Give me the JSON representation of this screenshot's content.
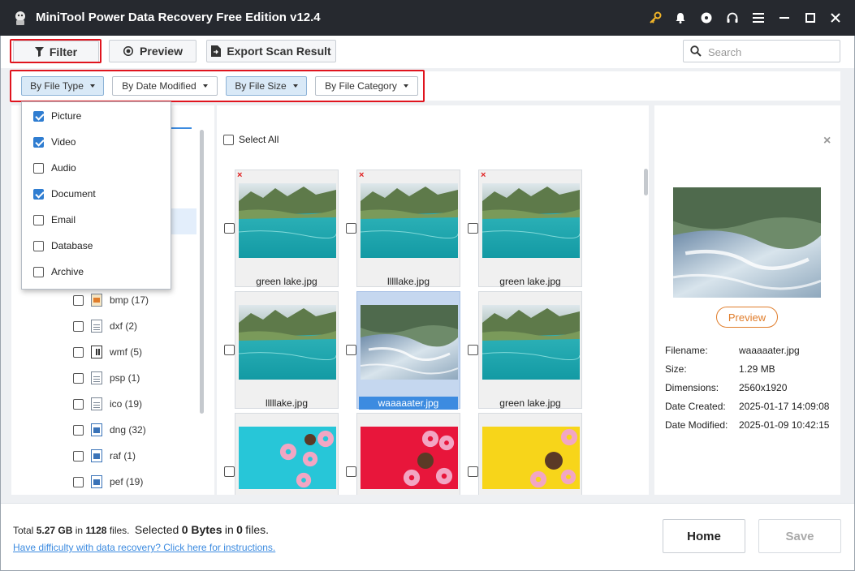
{
  "window": {
    "title": "MiniTool Power Data Recovery Free Edition v12.4"
  },
  "toolbar": {
    "filter_label": "Filter",
    "preview_label": "Preview",
    "export_label": "Export Scan Result",
    "search_placeholder": "Search"
  },
  "filterbar": {
    "by_file_type": "By File Type",
    "by_date_modified": "By Date Modified",
    "by_file_size": "By File Size",
    "by_file_category": "By File Category"
  },
  "file_type_dropdown": {
    "items": [
      {
        "label": "Picture",
        "checked": true
      },
      {
        "label": "Video",
        "checked": true
      },
      {
        "label": "Audio",
        "checked": false
      },
      {
        "label": "Document",
        "checked": true
      },
      {
        "label": "Email",
        "checked": false
      },
      {
        "label": "Database",
        "checked": false
      },
      {
        "label": "Archive",
        "checked": false
      }
    ]
  },
  "tree": {
    "items": [
      {
        "label": "bmp (17)",
        "icon": "bmp-file-icon"
      },
      {
        "label": "dxf (2)",
        "icon": "file-icon"
      },
      {
        "label": "wmf (5)",
        "icon": "wmf-file-icon"
      },
      {
        "label": "psp (1)",
        "icon": "file-icon"
      },
      {
        "label": "ico (19)",
        "icon": "file-icon"
      },
      {
        "label": "dng (32)",
        "icon": "image-file-icon"
      },
      {
        "label": "raf (1)",
        "icon": "image-file-icon"
      },
      {
        "label": "pef (19)",
        "icon": "image-file-icon"
      }
    ]
  },
  "grid": {
    "select_all_label": "Select All",
    "tiles": [
      {
        "name": "green lake.jpg",
        "thumb": "lake-teal",
        "deleted": true,
        "selected": false
      },
      {
        "name": "lllllake.jpg",
        "thumb": "lake-teal",
        "deleted": true,
        "selected": false
      },
      {
        "name": "green lake.jpg",
        "thumb": "lake-teal",
        "deleted": true,
        "selected": false
      },
      {
        "name": "lllllake.jpg",
        "thumb": "lake-teal",
        "deleted": false,
        "selected": false
      },
      {
        "name": "waaaaater.jpg",
        "thumb": "waterfall",
        "deleted": false,
        "selected": true
      },
      {
        "name": "green lake.jpg",
        "thumb": "lake-teal",
        "deleted": false,
        "selected": false
      },
      {
        "name": "",
        "thumb": "donuts-cyan",
        "deleted": false,
        "selected": false
      },
      {
        "name": "",
        "thumb": "donuts-red",
        "deleted": false,
        "selected": false
      },
      {
        "name": "",
        "thumb": "donuts-yellow",
        "deleted": false,
        "selected": false
      }
    ]
  },
  "preview_panel": {
    "preview_button": "Preview",
    "labels": {
      "filename": "Filename:",
      "size": "Size:",
      "dimensions": "Dimensions:",
      "date_created": "Date Created:",
      "date_modified": "Date Modified:"
    },
    "values": {
      "filename": "waaaaater.jpg",
      "size": "1.29 MB",
      "dimensions": "2560x1920",
      "date_created": "2025-01-17 14:09:08",
      "date_modified": "2025-01-09 10:42:15"
    }
  },
  "status": {
    "total_prefix": "Total",
    "total_size": "5.27 GB",
    "in": "in",
    "total_files": "1128",
    "files_suffix": "files.",
    "selected_prefix": "Selected",
    "selected_size": "0 Bytes",
    "selected_files": "0",
    "help_link": "Have difficulty with data recovery? Click here for instructions."
  },
  "actions": {
    "home_label": "Home",
    "save_label": "Save"
  },
  "colors": {
    "titlebar": "#26292f",
    "accent": "#2f7dd1",
    "highlight": "#e0141e",
    "preview_button": "#e07d2b"
  }
}
